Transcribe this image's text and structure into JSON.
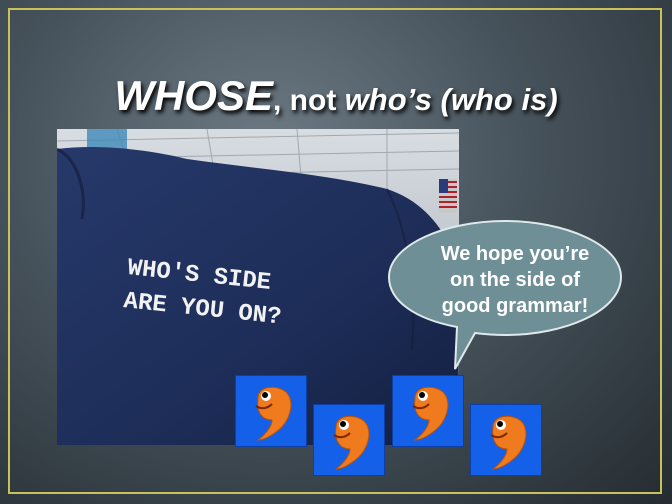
{
  "slide": {
    "title_part1": "WHOSE",
    "title_part2": ", not ",
    "title_part3": "who’s (who is)"
  },
  "photo": {
    "shirt_line1": "WHO'S SIDE",
    "shirt_line2": "ARE YOU ON?"
  },
  "callout": {
    "line1": "We hope you’re",
    "line2": "on the side of",
    "line3": "good grammar!"
  },
  "colors": {
    "border": "#c9c25a",
    "callout_fill": "#6f8f97",
    "comma_box": "#1560e8",
    "comma": "#f07a1e",
    "shirt": "#1c2c55"
  },
  "icons": [
    "comma-mascot-icon",
    "comma-mascot-icon",
    "comma-mascot-icon",
    "comma-mascot-icon"
  ]
}
